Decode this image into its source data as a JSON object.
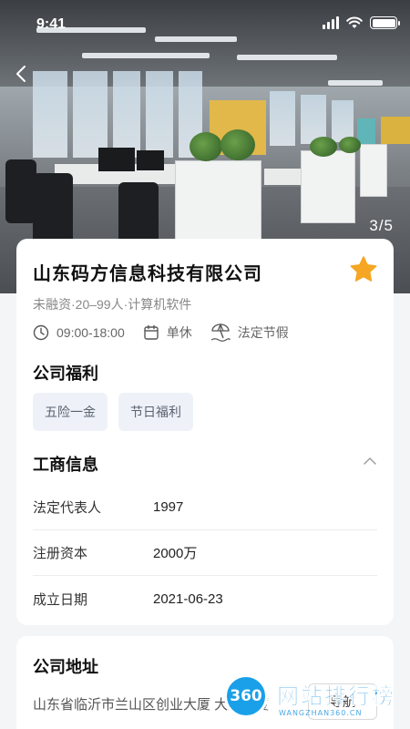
{
  "status_bar": {
    "time": "9:41"
  },
  "hero": {
    "photo_counter": "3/5"
  },
  "company": {
    "name": "山东码方信息科技有限公司",
    "tags": "未融资·20–99人·计算机软件",
    "favorited": true,
    "meta": [
      {
        "icon": "clock-icon",
        "text": "09:00-18:00"
      },
      {
        "icon": "calendar-icon",
        "text": "单休"
      },
      {
        "icon": "beach-umbrella-icon",
        "text": "法定节假"
      }
    ]
  },
  "benefits": {
    "title": "公司福利",
    "items": [
      "五险一金",
      "节日福利"
    ]
  },
  "business_info": {
    "title": "工商信息",
    "rows": [
      {
        "label": "法定代表人",
        "value": "1997"
      },
      {
        "label": "注册资本",
        "value": "2000万"
      },
      {
        "label": "成立日期",
        "value": "2021-06-23"
      }
    ]
  },
  "address": {
    "title": "公司地址",
    "text": "山东省临沂市兰山区创业大厦 大厦大厦",
    "nav_label": "导航"
  },
  "watermark": {
    "badge": "360",
    "name": "网站排行榜",
    "url": "WANGZHAN360.CN"
  },
  "colors": {
    "star": "#f5a623",
    "chip_bg": "#eef2f8",
    "chip_text": "#5b6270",
    "page_bg": "#f4f5f7"
  }
}
